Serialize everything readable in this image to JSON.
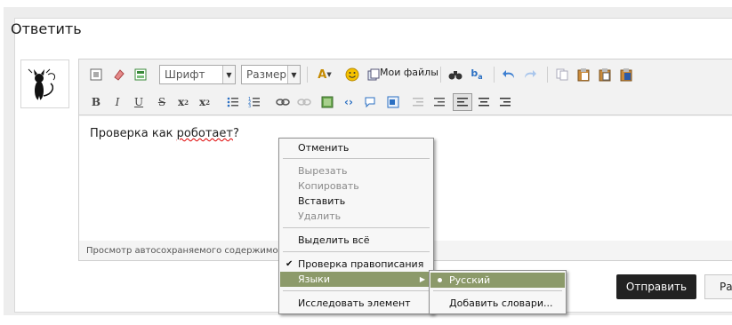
{
  "page": {
    "title": "Ответить"
  },
  "editor": {
    "font_combo": "Шрифт",
    "size_combo": "Размер",
    "my_files": "Мои файлы",
    "text_prefix": "Проверка как ",
    "text_misspelled": "роботает",
    "text_suffix": "?",
    "autosave_text": "Просмотр автосохраняемого содержимо"
  },
  "buttons": {
    "send": "Отправить",
    "preview": "Ра"
  },
  "context_menu": {
    "undo": "Отменить",
    "cut": "Вырезать",
    "copy": "Копировать",
    "paste": "Вставить",
    "delete": "Удалить",
    "select_all": "Выделить всё",
    "spellcheck": "Проверка правописания",
    "languages": "Языки",
    "inspect": "Исследовать элемент"
  },
  "languages_menu": {
    "russian": "Русский",
    "add_dictionaries": "Добавить словари..."
  },
  "colors": {
    "menu_highlight": "#8c9a6a",
    "send_bg": "#222222"
  }
}
